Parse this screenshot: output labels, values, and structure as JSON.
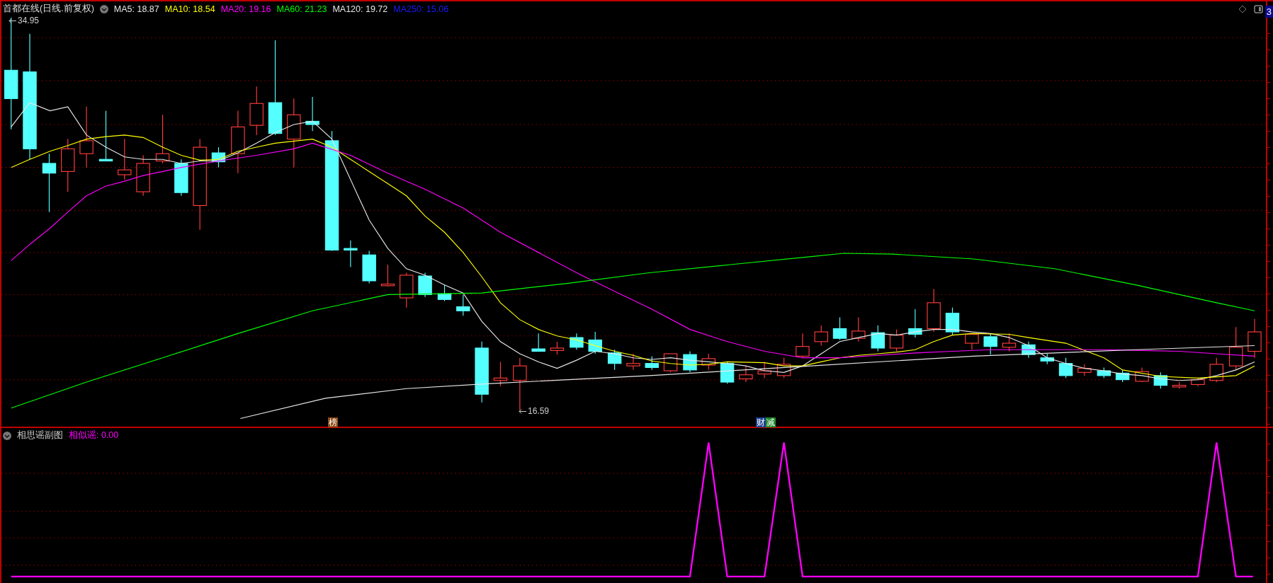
{
  "header": {
    "title": "首都在线(日线.前复权)",
    "indicators": [
      {
        "label": "MA5: 18.87",
        "color": "#e6e6e6"
      },
      {
        "label": "MA10: 18.54",
        "color": "#ffff00"
      },
      {
        "label": "MA20: 19.16",
        "color": "#ff00ff"
      },
      {
        "label": "MA60: 21.23",
        "color": "#00ff00"
      },
      {
        "label": "MA120: 19.72",
        "color": "#e6e6e6"
      },
      {
        "label": "MA250: 15.06",
        "color": "#1a1aff"
      }
    ]
  },
  "high_label": "34.95",
  "low_label": "16.59",
  "marker_groups": [
    {
      "items": [
        {
          "text": "榜",
          "color": "#8b4a14"
        }
      ]
    },
    {
      "items": [
        {
          "text": "财",
          "color": "#1d3f8c"
        },
        {
          "text": "减",
          "color": "#1f8a2a"
        }
      ]
    }
  ],
  "corner_badge": "3",
  "sub_panel": {
    "title": "相思谣副图",
    "indicator": "相似谣: 0.00"
  }
}
